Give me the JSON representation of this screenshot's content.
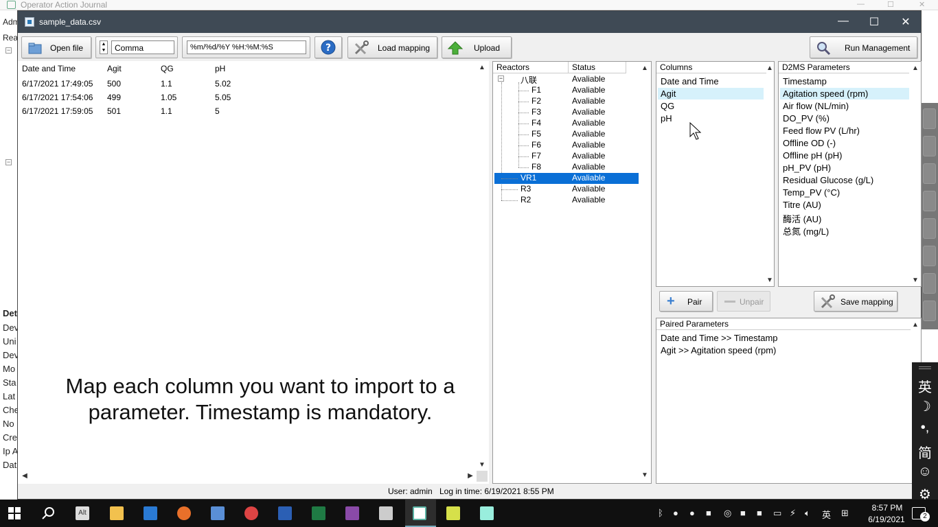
{
  "background_window": {
    "title": "Operator Action Journal",
    "fragments": [
      "Adm",
      "Rea",
      "Det",
      "Dev",
      "Uni",
      "Dev",
      "Mo",
      "Sta",
      "Lat",
      "Che",
      "No",
      "Cre",
      "Ip A",
      "Dat"
    ]
  },
  "dialog": {
    "title": "sample_data.csv",
    "toolbar": {
      "open_file": "Open file",
      "delimiter": "Comma",
      "date_format": "%m/%d/%Y %H:%M:%S",
      "load_mapping": "Load mapping",
      "upload": "Upload",
      "run_management": "Run Management"
    },
    "data_table": {
      "headers": [
        "Date and Time",
        "Agit",
        "QG",
        "pH"
      ],
      "rows": [
        [
          "6/17/2021 17:49:05",
          "500",
          "1.1",
          "5.02"
        ],
        [
          "6/17/2021 17:54:06",
          "499",
          "1.05",
          "5.05"
        ],
        [
          "6/17/2021 17:59:05",
          "501",
          "1.1",
          "5"
        ]
      ]
    },
    "reactors": {
      "headers": [
        "Reactors",
        "Status"
      ],
      "group": "八联",
      "items": [
        {
          "name": "八联",
          "status": "Avaliable"
        },
        {
          "name": "F1",
          "status": "Avaliable"
        },
        {
          "name": "F2",
          "status": "Avaliable"
        },
        {
          "name": "F3",
          "status": "Avaliable"
        },
        {
          "name": "F4",
          "status": "Avaliable"
        },
        {
          "name": "F5",
          "status": "Avaliable"
        },
        {
          "name": "F6",
          "status": "Avaliable"
        },
        {
          "name": "F7",
          "status": "Avaliable"
        },
        {
          "name": "F8",
          "status": "Avaliable"
        },
        {
          "name": "VR1",
          "status": "Avaliable"
        },
        {
          "name": "R3",
          "status": "Avaliable"
        },
        {
          "name": "R2",
          "status": "Avaliable"
        }
      ],
      "selected": "VR1"
    },
    "columns": {
      "header": "Columns",
      "items": [
        "Date and Time",
        "Agit",
        "QG",
        "pH"
      ],
      "highlighted": "Agit"
    },
    "parameters": {
      "header": "D2MS Parameters",
      "items": [
        "Timestamp",
        "Agitation speed (rpm)",
        "Air flow (NL/min)",
        "DO_PV (%)",
        "Feed flow PV (L/hr)",
        "Offline OD (-)",
        "Offline pH (pH)",
        "pH_PV (pH)",
        "Residual Glucose (g/L)",
        "Temp_PV (°C)",
        "Titre (AU)",
        "酶活 (AU)",
        "总氮 (mg/L)"
      ],
      "highlighted": "Agitation speed (rpm)"
    },
    "pair_buttons": {
      "pair": "Pair",
      "unpair": "Unpair",
      "save_mapping": "Save mapping"
    },
    "paired": {
      "header": "Paired Parameters",
      "items": [
        "Date and Time >> Timestamp",
        "Agit >> Agitation speed (rpm)"
      ]
    },
    "caption": "Map each column you want to import to a parameter. Timestamp is mandatory.",
    "status": {
      "user": "User: admin",
      "login": "Log in time: 6/19/2021 8:55 PM"
    }
  },
  "ime_bar": [
    "英",
    "☽",
    "•,",
    "简",
    "☺",
    "⚙"
  ],
  "taskbar": {
    "time": "8:57 PM",
    "date": "6/19/2021",
    "lang": "英",
    "notifications": "2"
  },
  "colors": {
    "title_bar": "#3f4a55",
    "selection": "#0a6fd6",
    "highlight": "#d6f1fb",
    "taskbar": "#101010"
  }
}
